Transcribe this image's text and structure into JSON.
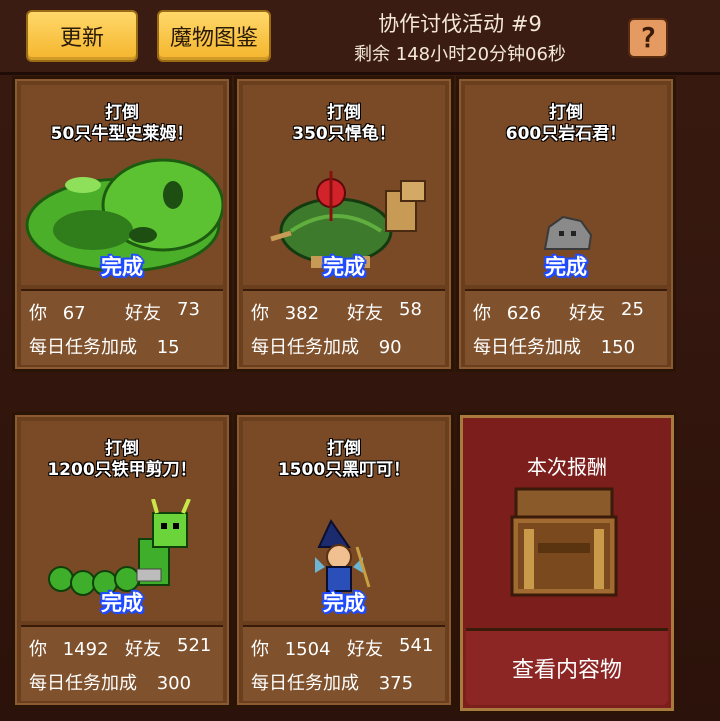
{
  "header": {
    "update_label": "更新",
    "bestiary_label": "魔物图鉴",
    "event_title": "协作讨伐活动 #9",
    "remaining": "剩余 148小时20分钟06秒",
    "help_glyph": "?"
  },
  "missions": [
    {
      "objective_line1": "打倒",
      "objective_line2": "50只牛型史莱姆！",
      "status": "完成",
      "you_label": "你",
      "you_value": "67",
      "friend_label": "好友",
      "friend_value": "73",
      "bonus_label": "每日任务加成",
      "bonus_value": "15",
      "monster_icon": "bull-slime-icon"
    },
    {
      "objective_line1": "打倒",
      "objective_line2": "350只悍龟！",
      "status": "完成",
      "you_label": "你",
      "you_value": "382",
      "friend_label": "好友",
      "friend_value": "58",
      "bonus_label": "每日任务加成",
      "bonus_value": "90",
      "monster_icon": "turtle-icon"
    },
    {
      "objective_line1": "打倒",
      "objective_line2": "600只岩石君！",
      "status": "完成",
      "you_label": "你",
      "you_value": "626",
      "friend_label": "好友",
      "friend_value": "25",
      "bonus_label": "每日任务加成",
      "bonus_value": "150",
      "monster_icon": "rock-icon"
    },
    {
      "objective_line1": "打倒",
      "objective_line2": "1200只铁甲剪刀！",
      "status": "完成",
      "you_label": "你",
      "you_value": "1492",
      "friend_label": "好友",
      "friend_value": "521",
      "bonus_label": "每日任务加成",
      "bonus_value": "300",
      "monster_icon": "armored-caterpillar-icon"
    },
    {
      "objective_line1": "打倒",
      "objective_line2": "1500只黑叮可！",
      "status": "完成",
      "you_label": "你",
      "you_value": "1504",
      "friend_label": "好友",
      "friend_value": "541",
      "bonus_label": "每日任务加成",
      "bonus_value": "375",
      "monster_icon": "dark-fairy-icon"
    }
  ],
  "reward": {
    "label": "本次报酬",
    "view_label": "查看内容物",
    "icon": "treasure-chest-icon"
  },
  "colors": {
    "accent_button": "#f4b52c",
    "done_outline": "#1f4bff",
    "reward_bg": "#7b1e1c"
  }
}
